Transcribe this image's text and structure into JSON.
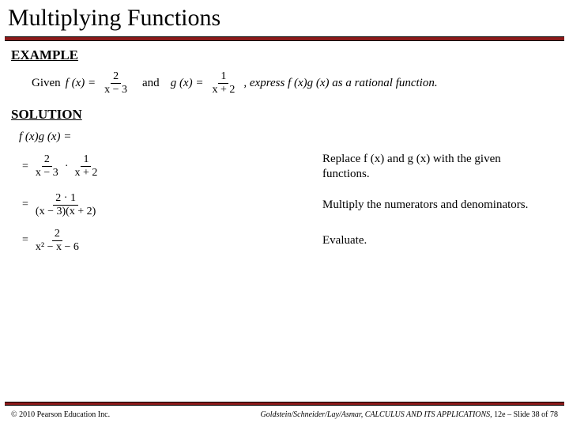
{
  "title": "Multiplying Functions",
  "headings": {
    "example": "EXAMPLE",
    "solution": "SOLUTION"
  },
  "example": {
    "given": "Given",
    "f_label": "f (x) =",
    "f_num": "2",
    "f_den": "x − 3",
    "and": "and",
    "g_label": "g (x) =",
    "g_num": "1",
    "g_den": "x + 2",
    "tail": ", express f (x)g (x) as a rational function."
  },
  "solution": {
    "fg": "f (x)g (x) =",
    "steps": [
      {
        "lhs_num": "2",
        "lhs_den": "x − 3",
        "dot": "·",
        "rhs_num": "1",
        "rhs_den": "x + 2",
        "explain": "Replace f (x) and g (x) with the given functions."
      },
      {
        "lhs_num": "2 · 1",
        "lhs_den": "(x − 3)(x + 2)",
        "explain": "Multiply the numerators and denominators."
      },
      {
        "lhs_num": "2",
        "lhs_den": "x² − x − 6",
        "explain": "Evaluate."
      }
    ]
  },
  "footer": {
    "left": "© 2010 Pearson Education Inc.",
    "right_italic": "Goldstein/Schneider/Lay/Asmar, CALCULUS AND ITS APPLICATIONS,",
    "right_tail": " 12e – Slide 38 of 78"
  }
}
